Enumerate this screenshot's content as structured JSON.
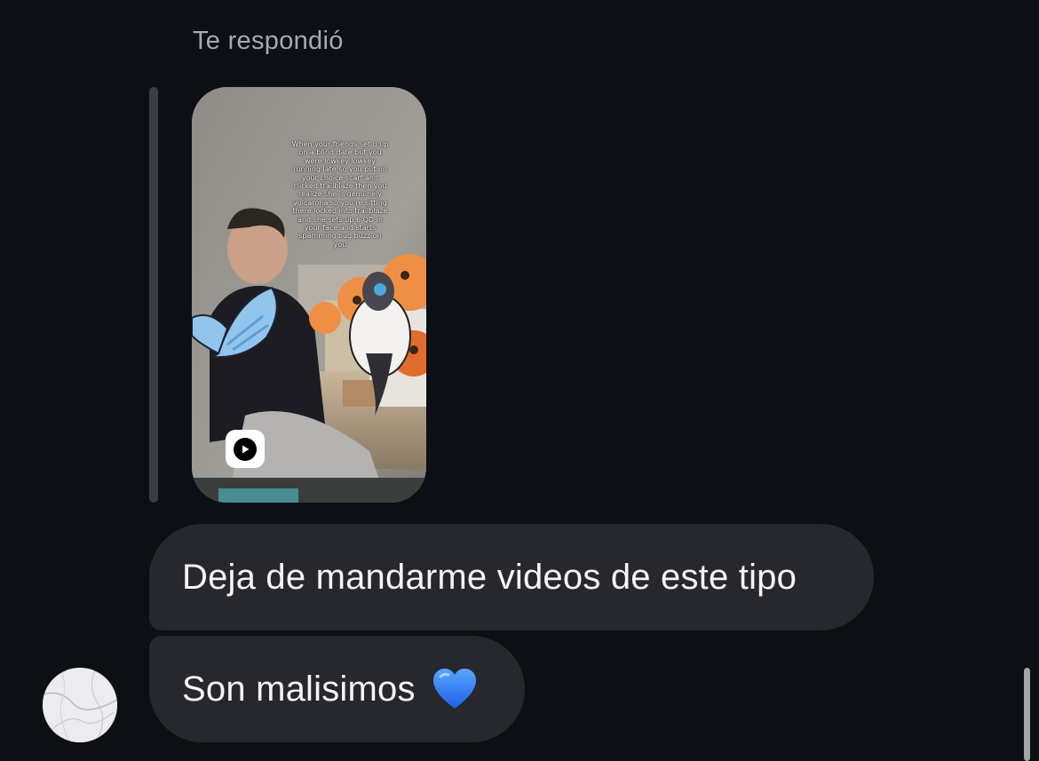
{
  "reply_header": {
    "label": "Te respondió"
  },
  "video_preview": {
    "overlay_caption": "When your friends set u up on a blind date but you were lowkey lowkey running late so you put on your choice scarf and clicked trailblaze then you realize she is genuinely volcarona so you're sitting there locked into trailblaze and she sets up 6 QD in your face and starts spamming bug buzz on you",
    "play_icon": "play-icon"
  },
  "messages": [
    {
      "text": "Deja de mandarme videos de este tipo"
    },
    {
      "text": "Son malisimos",
      "emoji": "blue-heart-icon"
    }
  ],
  "sender": {
    "avatar": "marble-avatar"
  },
  "colors": {
    "background": "#0c0f14",
    "bubble": "#26282d",
    "reply_label": "#a7aab0",
    "heart": "#2f7cf6"
  }
}
